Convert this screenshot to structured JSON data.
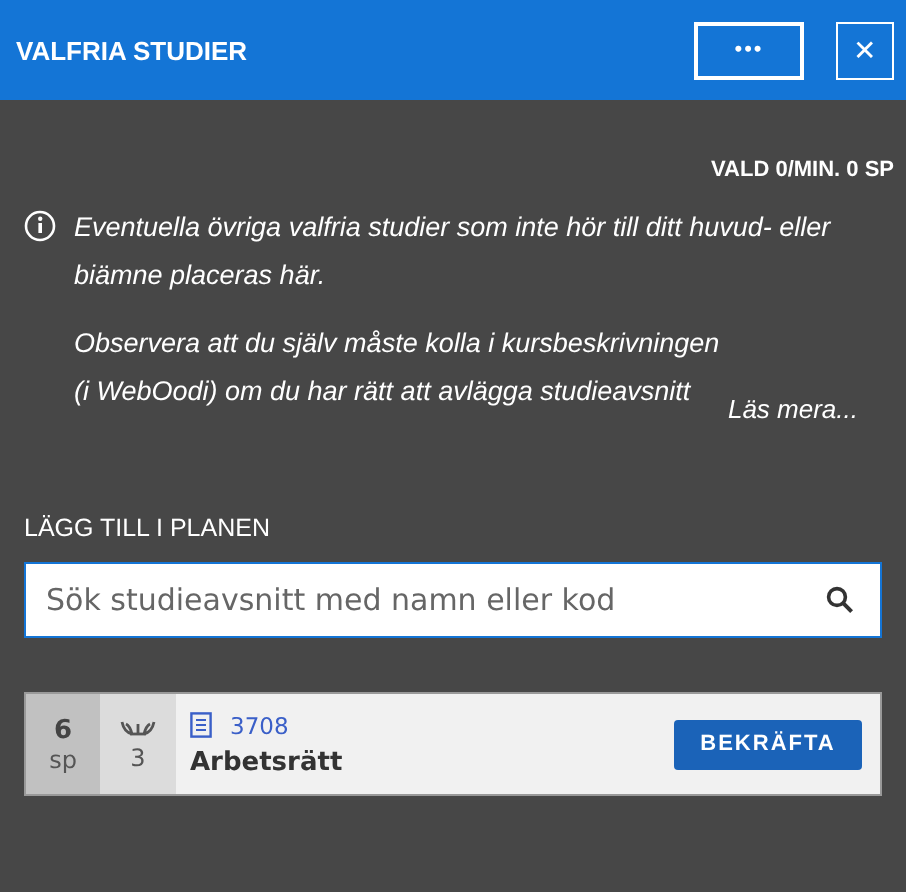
{
  "header": {
    "title": "VALFRIA STUDIER",
    "more_button": "•••",
    "close_button": "✕"
  },
  "credits": "VALD 0/MIN. 0 SP",
  "info": {
    "paragraphs": [
      "Eventuella övriga valfria studier som inte hör till ditt huvud- eller biämne placeras här.",
      "Observera att du själv måste kolla i kursbeskrivningen (i WebOodi) om du har rätt att avlägga studieavsnitt"
    ],
    "read_more": "Läs mera..."
  },
  "add_section": {
    "heading": "LÄGG TILL I PLANEN",
    "search": {
      "placeholder": "Sök studieavsnitt med namn eller kod"
    }
  },
  "courses": [
    {
      "credits": "6",
      "unit": "sp",
      "level": "3",
      "code": "3708",
      "name": "Arbetsrätt",
      "button": "BEKRÄFTA"
    }
  ]
}
